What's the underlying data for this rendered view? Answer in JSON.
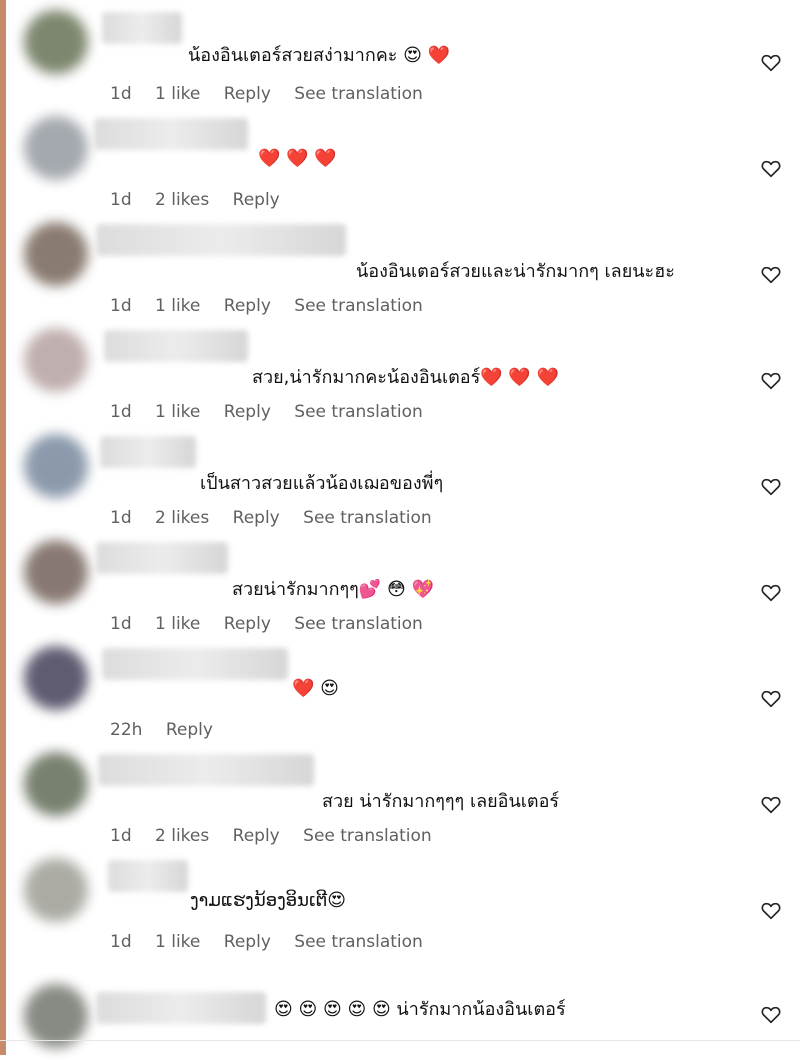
{
  "comments": [
    {
      "text": "น้องอินเตอร์สวยสง่ามากคะ 😍 ❤️",
      "time": "1d",
      "likes": "1 like",
      "reply": "Reply",
      "translate": "See translation"
    },
    {
      "text": "❤️ ❤️ ❤️",
      "time": "1d",
      "likes": "2 likes",
      "reply": "Reply",
      "translate": ""
    },
    {
      "text": "น้องอินเตอร์สวยและน่ารักมากๆ เลยนะฮะ",
      "time": "1d",
      "likes": "1 like",
      "reply": "Reply",
      "translate": "See translation"
    },
    {
      "text": "สวย,น่ารักมากคะน้องอินเตอร์❤️ ❤️ ❤️",
      "time": "1d",
      "likes": "1 like",
      "reply": "Reply",
      "translate": "See translation"
    },
    {
      "text": "เป็นสาวสวยแล้วน้องเฌอของพี่ๆ",
      "time": "1d",
      "likes": "2 likes",
      "reply": "Reply",
      "translate": "See translation"
    },
    {
      "text": "สวยน่ารักมากๆๆ💕 😳 💖",
      "time": "1d",
      "likes": "1 like",
      "reply": "Reply",
      "translate": "See translation"
    },
    {
      "text": "❤️ 😍",
      "time": "22h",
      "likes": "",
      "reply": "Reply",
      "translate": ""
    },
    {
      "text": "สวย น่ารักมากๆๆๆ เลยอินเตอร์",
      "time": "1d",
      "likes": "2 likes",
      "reply": "Reply",
      "translate": "See translation"
    },
    {
      "text": "ງາມແຮງນ້ອງອິນເຕີ😍",
      "time": "1d",
      "likes": "1 like",
      "reply": "Reply",
      "translate": "See translation"
    },
    {
      "text": "😍 😍 😍 😍 😍 น่ารักมากน้องอินเตอร์",
      "time": "",
      "likes": "",
      "reply": "",
      "translate": ""
    }
  ],
  "icons": {
    "like": "heart-outline-icon"
  },
  "colors": {
    "meta": "#606060",
    "heart": "#e0192e",
    "strip": "#c98a6a"
  }
}
